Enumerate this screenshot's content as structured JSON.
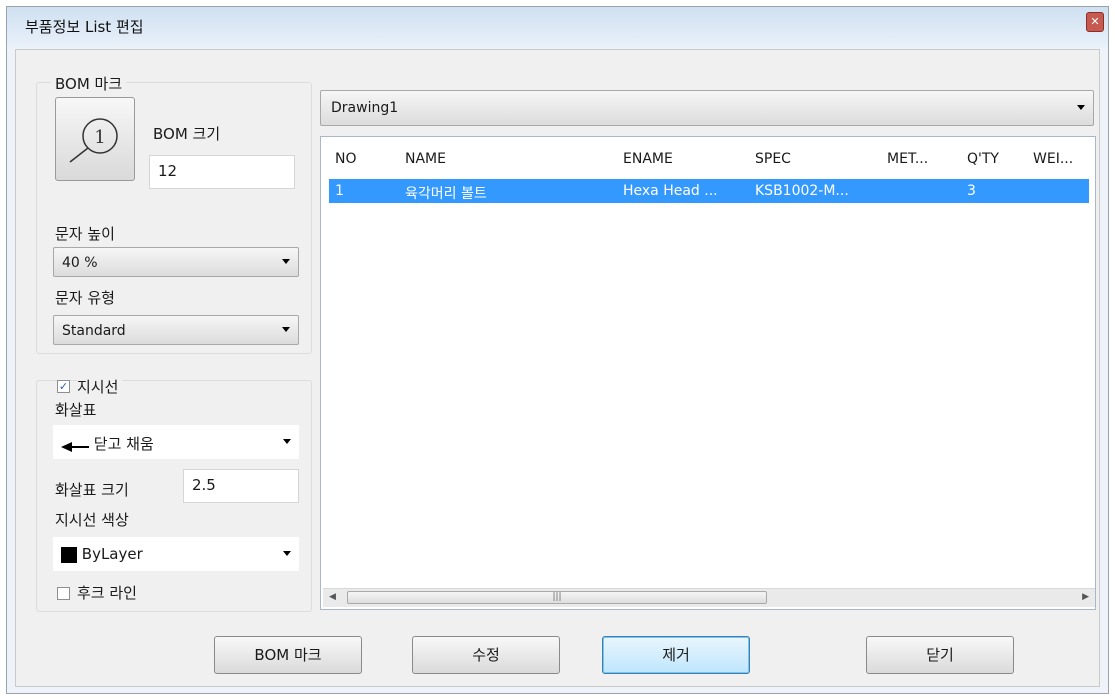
{
  "window": {
    "title": "부품정보 List 편집",
    "close_icon": "close-icon"
  },
  "bom_group": {
    "title": "BOM 마크",
    "size_label": "BOM 크기",
    "size_value": "12",
    "text_height_label": "문자 높이",
    "text_height_value": "40 %",
    "text_type_label": "문자 유형",
    "text_type_value": "Standard"
  },
  "leader_group": {
    "leader_checkbox_label": "지시선",
    "leader_checked": true,
    "arrow_label": "화살표",
    "arrow_value": "닫고 채움",
    "arrow_size_label": "화살표 크기",
    "arrow_size_value": "2.5",
    "leader_color_label": "지시선 색상",
    "leader_color_value": "ByLayer",
    "leader_color_swatch": "#000000",
    "hook_line_label": "후크 라인",
    "hook_line_checked": false
  },
  "drawing_combo": {
    "value": "Drawing1"
  },
  "table": {
    "columns": [
      "NO",
      "NAME",
      "ENAME",
      "SPEC",
      "MET...",
      "Q'TY",
      "WEI..."
    ],
    "rows": [
      {
        "no": "1",
        "name": "육각머리 볼트",
        "ename": "Hexa Head ...",
        "spec": "KSB1002-M...",
        "met": "",
        "qty": "3",
        "wei": ""
      }
    ],
    "selection_color": "#3399ff"
  },
  "buttons": {
    "bom_mark": "BOM 마크",
    "edit": "수정",
    "remove": "제거",
    "close": "닫기"
  }
}
